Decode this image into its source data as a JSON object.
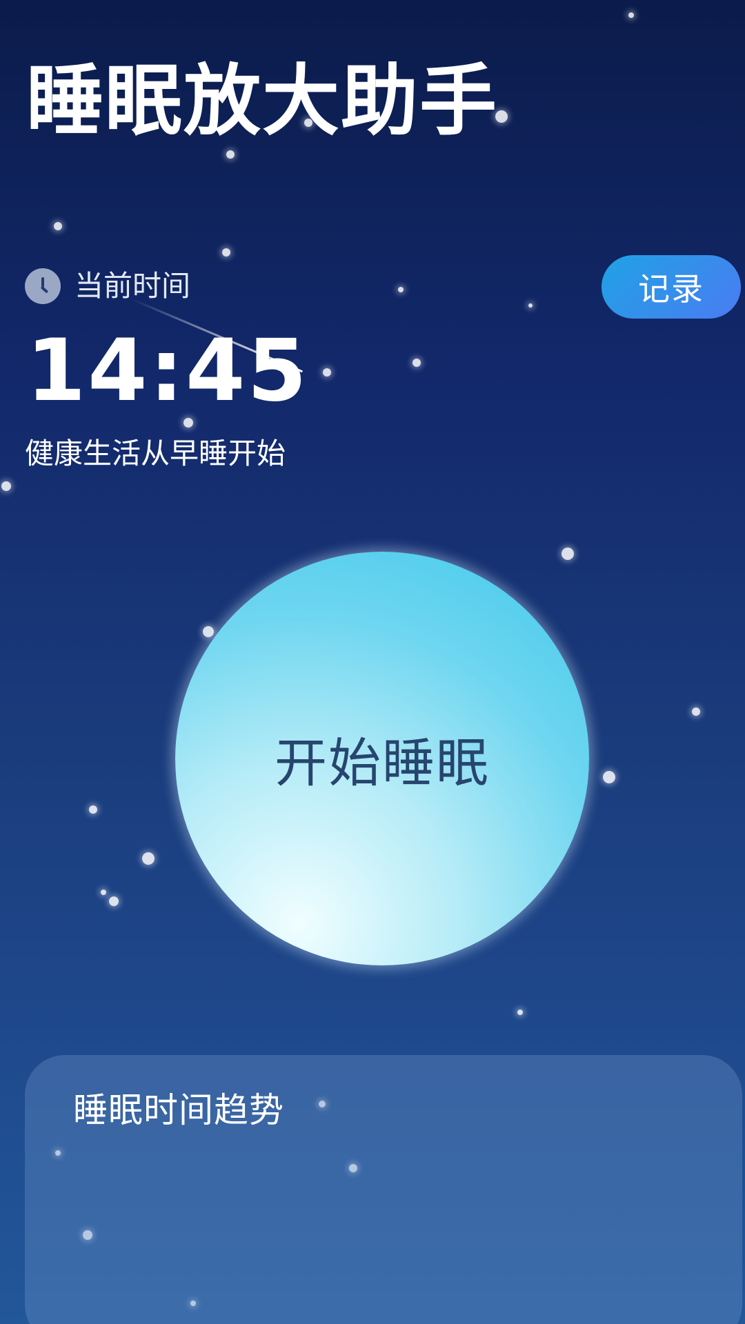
{
  "app": {
    "title": "睡眠放大助手"
  },
  "clock": {
    "label": "当前时间",
    "time": "14:45",
    "icon": "clock-icon"
  },
  "slogan": "健康生活从早睡开始",
  "record_button": {
    "label": "记录",
    "color_start": "#20a2e4",
    "color_end": "#4a7cf2"
  },
  "sleep_button": {
    "label": "开始睡眠",
    "color": "#3fc8ec"
  },
  "trend_card": {
    "title": "睡眠时间趋势"
  },
  "theme": {
    "background_top": "#0b1c4b",
    "background_bottom": "#22579a"
  }
}
